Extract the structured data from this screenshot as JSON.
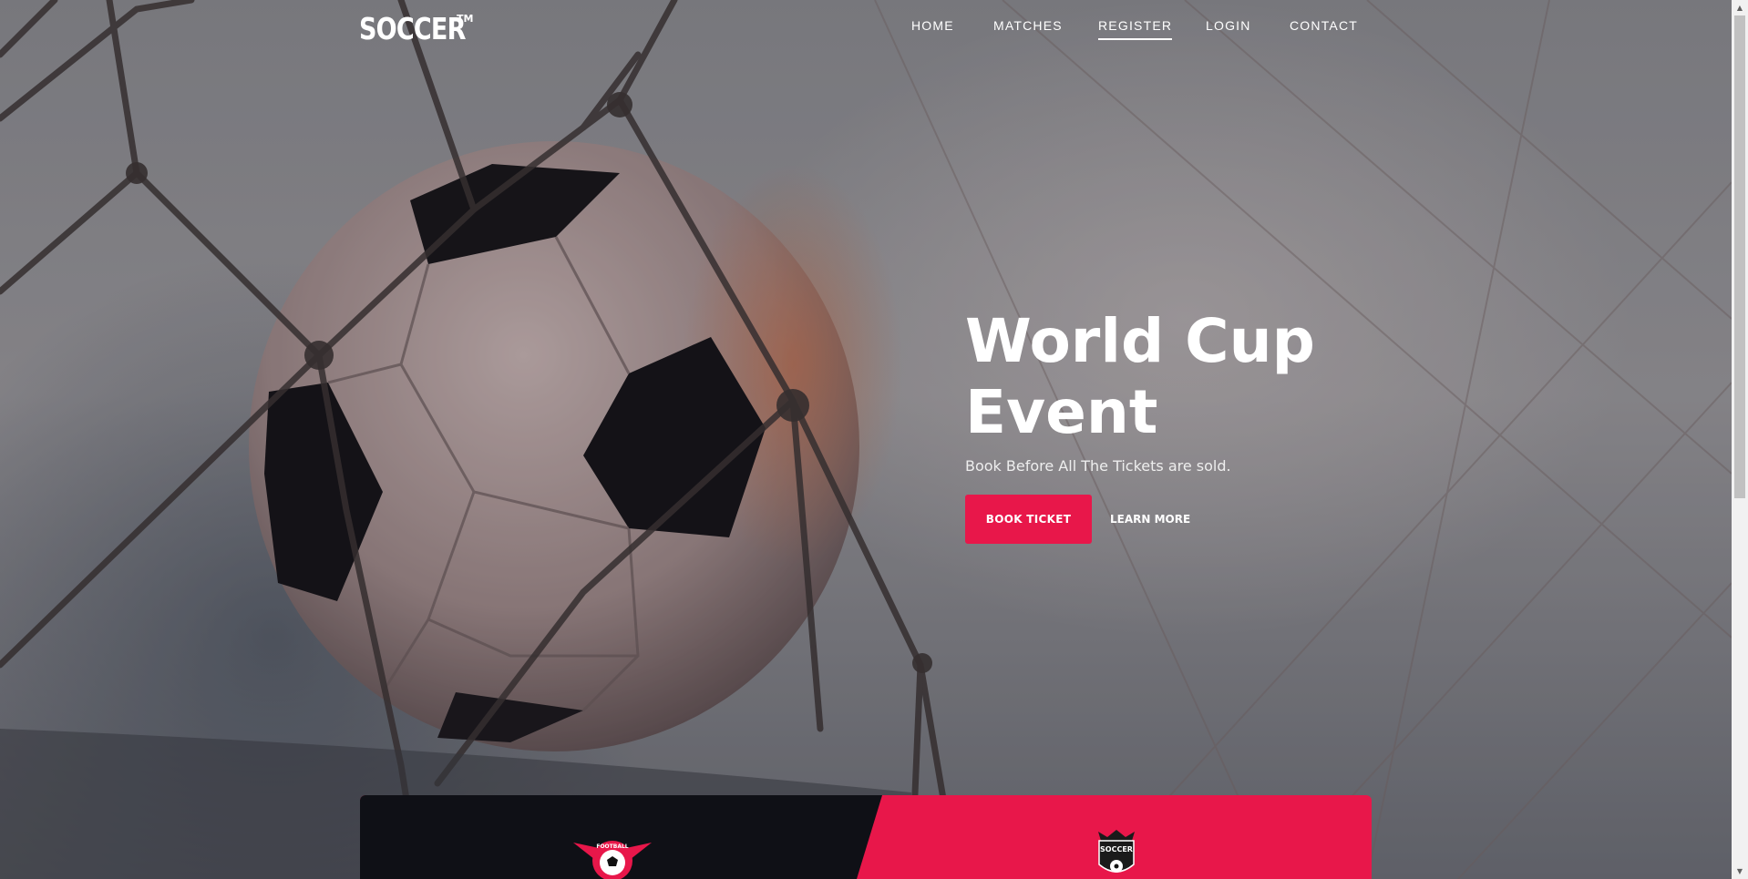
{
  "brand": {
    "logo": "SOCCER",
    "trademark": "TM"
  },
  "nav": {
    "items": [
      {
        "label": "HOME"
      },
      {
        "label": "MATCHES"
      },
      {
        "label": "REGISTER",
        "active": true
      },
      {
        "label": "LOGIN"
      },
      {
        "label": "CONTACT"
      }
    ]
  },
  "hero": {
    "title_line1": "World Cup",
    "title_line2": "Event",
    "subtitle": "Book Before All The Tickets are sold.",
    "primary_button": "BOOK TICKET",
    "secondary_link": "LEARN MORE"
  },
  "match_card": {
    "home_badge_text": "FOOTBALL",
    "away_badge_text": "SOCCER"
  },
  "colors": {
    "accent": "#e8174a",
    "dark": "#0f1016",
    "text_light": "#ffffff"
  },
  "icons": {
    "scroll_up": "scroll-up-arrow-icon",
    "scroll_down": "scroll-down-arrow-icon"
  }
}
